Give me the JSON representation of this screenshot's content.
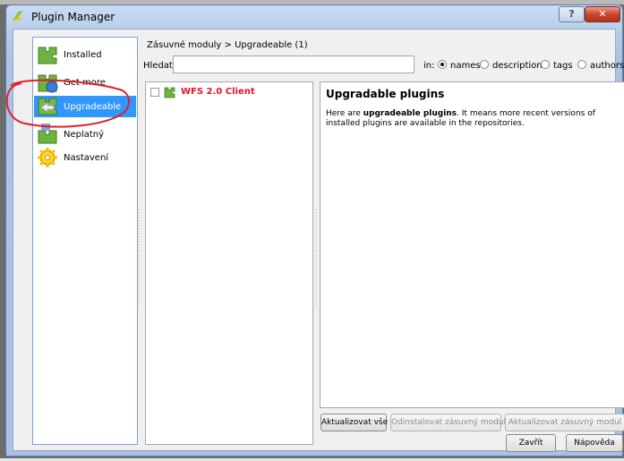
{
  "window": {
    "title": "Plugin Manager",
    "help_glyph": "?",
    "close_glyph": "✕"
  },
  "sidebar": {
    "items": [
      {
        "label": "Installed",
        "icon": "puzzle-installed-icon"
      },
      {
        "label": "Get more",
        "icon": "puzzle-get-more-icon"
      },
      {
        "label": "Upgradeable",
        "icon": "puzzle-upgradeable-icon",
        "active": true
      },
      {
        "label": "Neplatný",
        "icon": "puzzle-invalid-icon"
      },
      {
        "label": "Nastavení",
        "icon": "gear-settings-icon"
      }
    ]
  },
  "main": {
    "breadcrumb": "Zásuvné moduly > Upgradeable (1)",
    "search": {
      "label": "Hledat",
      "value": "",
      "placeholder": ""
    },
    "filter": {
      "in_label": "in:",
      "options": [
        {
          "label": "names",
          "checked": true
        },
        {
          "label": "descriptions",
          "checked": false
        },
        {
          "label": "tags",
          "checked": false
        },
        {
          "label": "authors",
          "checked": false
        }
      ]
    },
    "plugins": [
      {
        "name": "WFS 2.0 Client",
        "checked": false
      }
    ],
    "details": {
      "title": "Upgradable plugins",
      "text_pre": "Here are ",
      "text_bold": "upgradeable plugins",
      "text_post": ". It means more recent versions of installed plugins are available in the repositories."
    },
    "actions": {
      "upgrade_all": "Aktualizovat vše",
      "uninstall": "Odinstalovat zásuvný modul",
      "upgrade": "Aktualizovat zásuvný modul"
    },
    "footer": {
      "close": "Zavřít",
      "help": "Nápověda"
    }
  },
  "colors": {
    "selection": "#3297fd",
    "plugin_name": "#e8102a",
    "annotation": "#e0202a"
  }
}
